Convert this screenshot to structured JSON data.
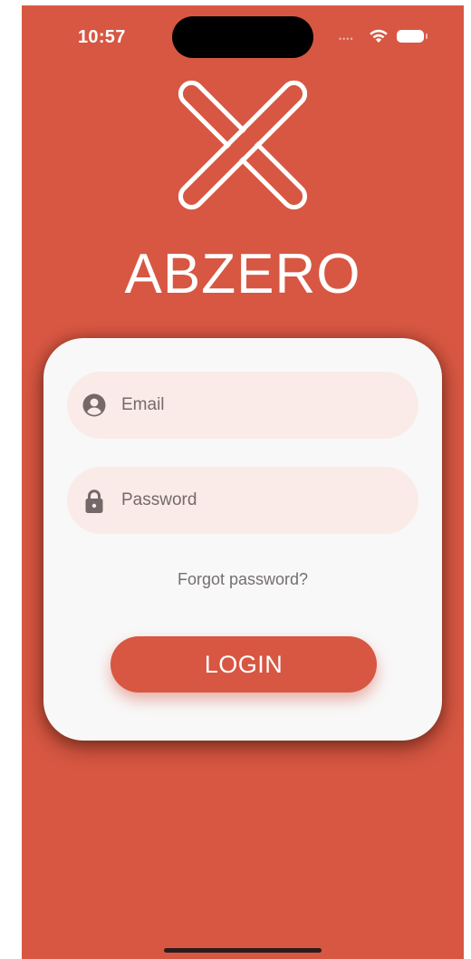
{
  "status_bar": {
    "time": "10:57",
    "signal_dots": "••••",
    "wifi_icon": "wifi-icon",
    "battery_icon": "battery-icon"
  },
  "brand": {
    "logo_icon": "x-logo-icon",
    "name": "ABZERO"
  },
  "login_form": {
    "email": {
      "placeholder": "Email",
      "value": "",
      "icon": "account-circle-icon"
    },
    "password": {
      "placeholder": "Password",
      "value": "",
      "icon": "lock-icon"
    },
    "forgot_password_label": "Forgot password?",
    "login_button_label": "LOGIN"
  },
  "colors": {
    "background": "#d75742",
    "card": "#f8f8f8",
    "field_background": "#faebe8",
    "button": "#d75742",
    "text_muted": "#756f6f"
  }
}
